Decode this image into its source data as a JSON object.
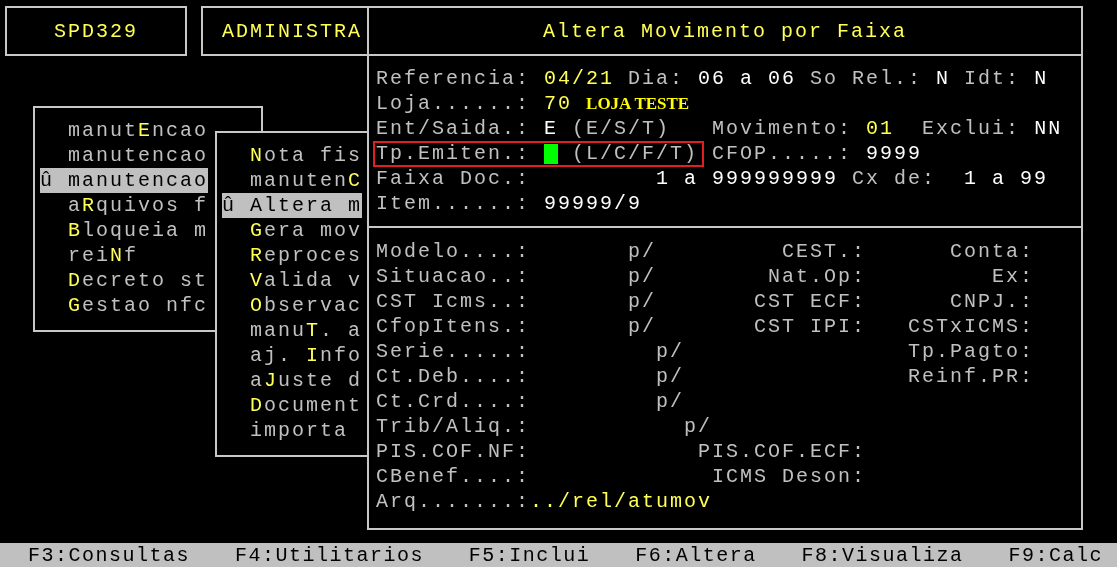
{
  "header_boxes": [
    {
      "text": "SPD329"
    },
    {
      "text": "ADMINISTRA"
    }
  ],
  "menus": [
    {
      "marker": "û",
      "items": [
        {
          "label": "manut**E**ncao",
          "selected": false
        },
        {
          "label": "manutencao",
          "selected": false
        },
        {
          "label": "manutencao",
          "selected": true
        },
        {
          "label": "a**R**quivos f",
          "selected": false
        },
        {
          "label": "**B**loqueia m",
          "selected": false
        },
        {
          "label": "rei**N**f",
          "selected": false
        },
        {
          "label": "**D**ecreto st",
          "selected": false
        },
        {
          "label": "**G**estao nfc",
          "selected": false
        }
      ]
    },
    {
      "marker": "û",
      "items": [
        {
          "label": "**N**ota fis",
          "selected": false
        },
        {
          "label": "manuten**C**",
          "selected": false
        },
        {
          "label": "Altera m",
          "selected": true
        },
        {
          "label": "**G**era mov",
          "selected": false
        },
        {
          "label": "**R**eproces",
          "selected": false
        },
        {
          "label": "**V**alida v",
          "selected": false
        },
        {
          "label": "**O**bservac",
          "selected": false
        },
        {
          "label": "manu**T**. a",
          "selected": false
        },
        {
          "label": "aj. **I**nfo",
          "selected": false
        },
        {
          "label": "a**J**uste d",
          "selected": false
        },
        {
          "label": "**D**ocument",
          "selected": false
        },
        {
          "label": "importa",
          "selected": false
        }
      ]
    }
  ],
  "dialog": {
    "title": "Altera Movimento por Faixa",
    "header_rows": [
      {
        "segments": [
          {
            "text": "Referencia:",
            "kind": "label"
          },
          {
            "text": "04/21",
            "kind": "accent"
          },
          {
            "text": "Dia:",
            "kind": "label"
          },
          {
            "text": "06 a 06",
            "kind": "value"
          },
          {
            "text": "So Rel.:",
            "kind": "label"
          },
          {
            "text": "N",
            "kind": "value"
          },
          {
            "text": "Idt:",
            "kind": "label"
          },
          {
            "text": "N",
            "kind": "value"
          }
        ]
      },
      {
        "segments": [
          {
            "text": "Loja......:",
            "kind": "label"
          },
          {
            "text": "70",
            "kind": "accent"
          },
          {
            "text": "LOJA TESTE",
            "kind": "caption"
          }
        ]
      },
      {
        "segments": [
          {
            "text": "Ent/Saida.:",
            "kind": "label"
          },
          {
            "text": "E",
            "kind": "value"
          },
          {
            "text": "(E/S/T)",
            "kind": "label"
          },
          {
            "text": "Movimento:",
            "kind": "label"
          },
          {
            "text": "01",
            "kind": "accent"
          },
          {
            "text": "Exclui:",
            "kind": "label"
          },
          {
            "text": "NN",
            "kind": "value"
          }
        ]
      },
      {
        "frame": {
          "segments": [
            {
              "text": "Tp.Emiten.:",
              "kind": "label"
            },
            {
              "kind": "cursor"
            },
            {
              "text": "(L/C/F/T)",
              "kind": "label"
            }
          ]
        },
        "segments": [
          {
            "text": "CFOP.....:",
            "kind": "label"
          },
          {
            "text": "9999",
            "kind": "value"
          }
        ]
      },
      {
        "segments": [
          {
            "text": "Faixa Doc.:",
            "kind": "label"
          },
          {
            "text": "1 a 999999999",
            "kind": "value"
          },
          {
            "text": "Cx de:",
            "kind": "label"
          },
          {
            "text": "1 a 99",
            "kind": "value"
          }
        ]
      },
      {
        "segments": [
          {
            "text": "Item......:",
            "kind": "label"
          },
          {
            "text": "99999/9",
            "kind": "value"
          }
        ]
      }
    ],
    "detail_rows": [
      {
        "label": "Modelo....:",
        "slot": "p/",
        "mid_label": "CEST.:",
        "right_label": "Conta:"
      },
      {
        "label": "Situacao..:",
        "slot": "p/",
        "mid_label": "Nat.Op:",
        "right_label": "Ex:"
      },
      {
        "label": "CST Icms..:",
        "slot": "p/",
        "mid_label": "CST ECF:",
        "right_label": "CNPJ.:"
      },
      {
        "label": "CfopItens.:",
        "slot": "p/",
        "mid_label": "CST IPI:",
        "right_label": "CSTxICMS:"
      },
      {
        "label": "Serie.....:",
        "slot": "p/",
        "right_label": "Tp.Pagto:"
      },
      {
        "label": "Ct.Deb....:",
        "slot": "p/",
        "right_label": "Reinf.PR:"
      },
      {
        "label": "Ct.Crd....:",
        "slot": "p/"
      },
      {
        "label": "Trib/Aliq.:",
        "slot": "p/"
      },
      {
        "label": "PIS.COF.NF:",
        "mid_label": "PIS.COF.ECF:"
      },
      {
        "label": "CBenef....:",
        "mid_label": "ICMS Deson:"
      },
      {
        "label": "Arq.......:",
        "value": "../rel/atumov"
      }
    ]
  },
  "function_keys": [
    "F3:Consultas",
    "F4:Utilitarios",
    "F5:Inclui",
    "F6:Altera",
    "F8:Visualiza",
    "F9:Calc"
  ]
}
